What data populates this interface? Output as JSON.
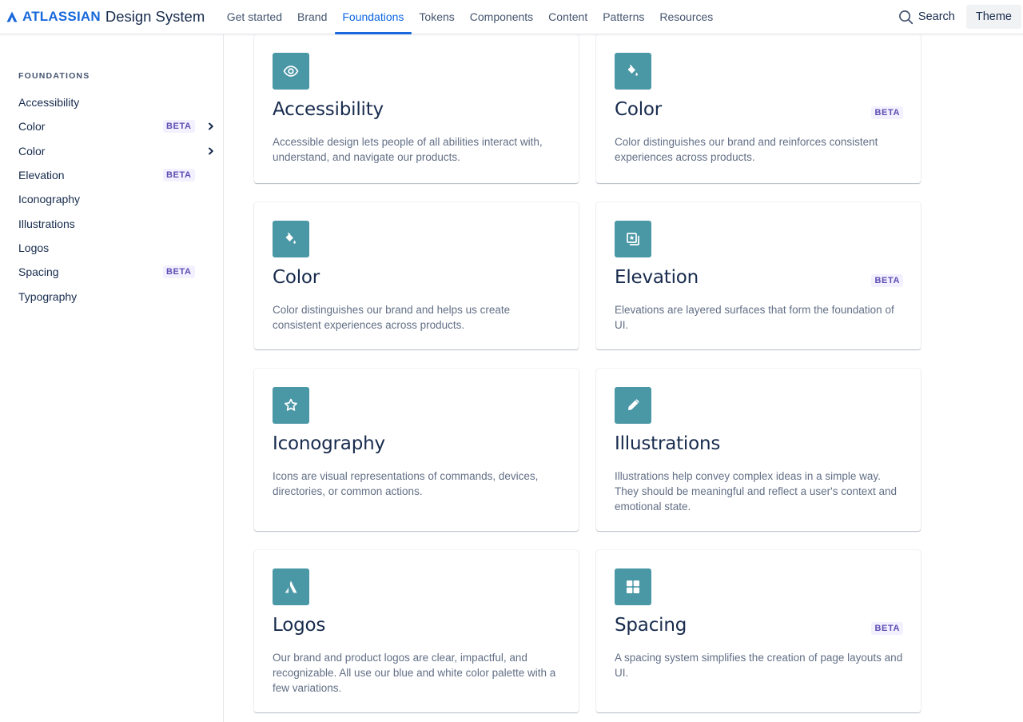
{
  "brand": {
    "wordmark": "ATLASSIAN",
    "product": "Design System",
    "accent_color": "#1868DB"
  },
  "nav": {
    "links": [
      {
        "label": "Get started",
        "active": false
      },
      {
        "label": "Brand",
        "active": false
      },
      {
        "label": "Foundations",
        "active": true
      },
      {
        "label": "Tokens",
        "active": false
      },
      {
        "label": "Components",
        "active": false
      },
      {
        "label": "Content",
        "active": false
      },
      {
        "label": "Patterns",
        "active": false
      },
      {
        "label": "Resources",
        "active": false
      }
    ],
    "search_label": "Search",
    "search_icon": "search-icon",
    "theme_label": "Theme"
  },
  "sidebar": {
    "heading": "FOUNDATIONS",
    "items": [
      {
        "label": "Accessibility",
        "badge": null,
        "chevron": false
      },
      {
        "label": "Color",
        "badge": "BETA",
        "chevron": true
      },
      {
        "label": "Color",
        "badge": null,
        "chevron": true
      },
      {
        "label": "Elevation",
        "badge": "BETA",
        "chevron": false
      },
      {
        "label": "Iconography",
        "badge": null,
        "chevron": false
      },
      {
        "label": "Illustrations",
        "badge": null,
        "chevron": false
      },
      {
        "label": "Logos",
        "badge": null,
        "chevron": false
      },
      {
        "label": "Spacing",
        "badge": "BETA",
        "chevron": false
      },
      {
        "label": "Typography",
        "badge": null,
        "chevron": false
      }
    ]
  },
  "cards": [
    {
      "title": "Accessibility",
      "icon": "eye-icon",
      "badge": null,
      "description": "Accessible design lets people of all abilities interact with, understand, and navigate our products."
    },
    {
      "title": "Color",
      "icon": "paint-bucket-icon",
      "badge": "BETA",
      "description": "Color distinguishes our brand and reinforces consistent experiences across products."
    },
    {
      "title": "Color",
      "icon": "paint-bucket-icon",
      "badge": null,
      "description": "Color distinguishes our brand and helps us create consistent experiences across products."
    },
    {
      "title": "Elevation",
      "icon": "layers-star-icon",
      "badge": "BETA",
      "description": "Elevations are layered surfaces that form the foundation of UI."
    },
    {
      "title": "Iconography",
      "icon": "star-icon",
      "badge": null,
      "description": "Icons are visual representations of commands, devices, directories, or common actions."
    },
    {
      "title": "Illustrations",
      "icon": "pencil-icon",
      "badge": null,
      "description": "Illustrations help convey complex ideas in a simple way. They should be meaningful and reflect a user's context and emotional state."
    },
    {
      "title": "Logos",
      "icon": "atlassian-logo-icon",
      "badge": null,
      "description": "Our brand and product logos are clear, impactful, and recognizable. All use our blue and white color palette with a few variations."
    },
    {
      "title": "Spacing",
      "icon": "grid-icon",
      "badge": "BETA",
      "description": "A spacing system simplifies the creation of page layouts and UI."
    }
  ],
  "colors": {
    "icon_tile": "#4A97A6",
    "beta_bg": "#F3F0FF",
    "beta_text": "#5E4DB2",
    "active_nav": "#0C66E4"
  }
}
